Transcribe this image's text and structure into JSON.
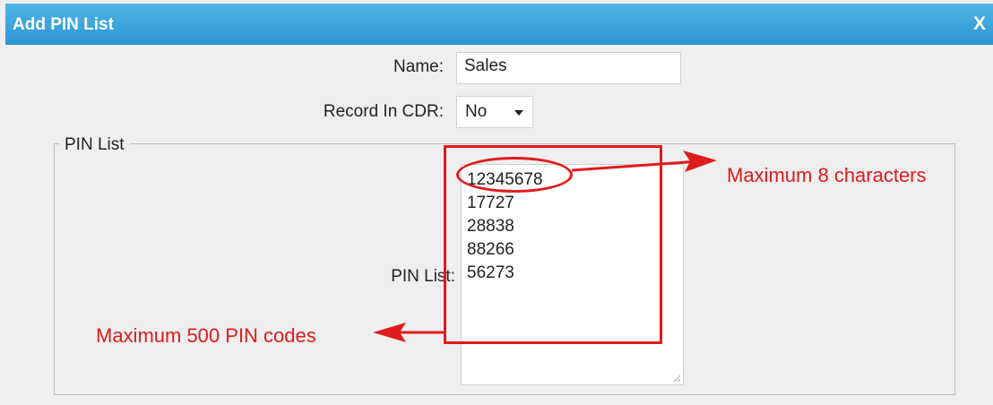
{
  "dialog": {
    "title": "Add PIN List",
    "close_label": "X"
  },
  "form": {
    "name_label": "Name:",
    "name_value": "Sales",
    "record_label": "Record In CDR:",
    "record_value": "No",
    "section_legend": "PIN List",
    "pin_list_label": "PIN List:",
    "pin_codes": [
      "12345678",
      "17727",
      "28838",
      "88266",
      "56273"
    ]
  },
  "annotations": {
    "max_chars": "Maximum 8 characters",
    "max_codes": "Maximum 500 PIN codes",
    "accent_color": "#e01b1b"
  }
}
